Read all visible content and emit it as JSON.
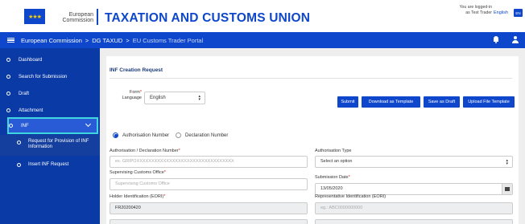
{
  "header": {
    "org_line1": "European",
    "org_line2": "Commission",
    "title": "TAXATION AND CUSTOMS UNION",
    "login_line1": "You are logged-in",
    "login_line2": "as Test Trader",
    "language": "English",
    "language_code": "EN"
  },
  "navbar": {
    "crumb1": "European Commission",
    "crumb2": "DG TAXUD",
    "crumb3": "EU Customs Trader Portal",
    "separator": ">"
  },
  "sidebar": {
    "items": [
      {
        "label": "Dashboard"
      },
      {
        "label": "Search for Submission"
      },
      {
        "label": "Draft"
      },
      {
        "label": "Attachment"
      },
      {
        "label": "INF"
      }
    ],
    "sub_items": [
      {
        "label": "Request for Provision of INF Information"
      },
      {
        "label": "Insert INF Request"
      }
    ]
  },
  "form": {
    "title": "INF Creation Request",
    "language_label_1": "Form",
    "language_label_2": "Language",
    "language_value": "English",
    "buttons": {
      "submit": "Submit",
      "download_template": "Download as Template",
      "save_draft": "Save as Draft",
      "upload_template": "Upload File Template"
    },
    "radio_authorisation": "Authorisation Number",
    "radio_declaration": "Declaration Number",
    "auth_decl_label": "Authorisation / Declaration Number",
    "auth_decl_placeholder": "ex. GRIPOXXXXXXXXXXXXXXXXXXXXXXXXXXXXXXXXX",
    "auth_type_label": "Authorisation Type",
    "auth_type_value": "Select an option",
    "supervising_label": "Supervising Customs Office",
    "supervising_placeholder": "Supervising Customs Office",
    "submission_date_label": "Submission Date",
    "submission_date_value": "13/05/2020",
    "holder_label": "Holder Identification (EORI)",
    "holder_value": "FR20200420",
    "rep_label": "Representative Identification (EORI)",
    "rep_placeholder": "eg.: ABC0000000000"
  },
  "colors": {
    "brand_blue": "#0e47cb",
    "sidebar_blue": "#0a3aa6",
    "active_outline": "#3fd6e0"
  }
}
